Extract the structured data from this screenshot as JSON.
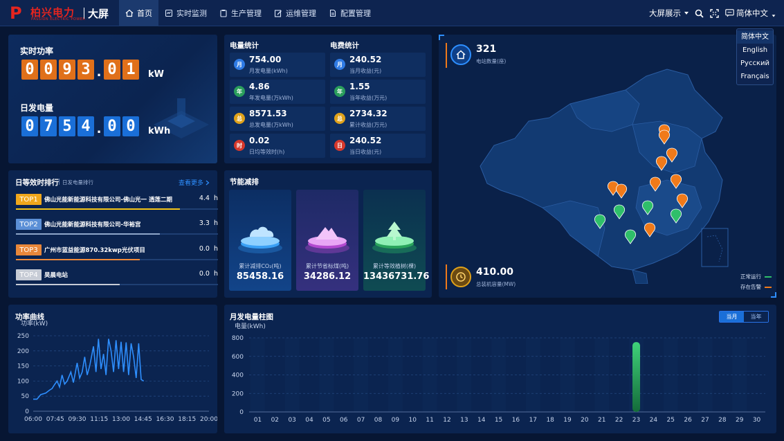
{
  "header": {
    "logo_text": "柏兴电力",
    "logo_subtext": "PASSION ELECTRIC POWER",
    "title": "大屏",
    "nav": [
      {
        "label": "首页",
        "icon": "home-icon",
        "active": true
      },
      {
        "label": "实时监测",
        "icon": "monitor-icon",
        "active": false
      },
      {
        "label": "生产管理",
        "icon": "clipboard-icon",
        "active": false
      },
      {
        "label": "运维管理",
        "icon": "edit-icon",
        "active": false
      },
      {
        "label": "配置管理",
        "icon": "document-icon",
        "active": false
      }
    ],
    "display_mode": "大屏展示",
    "language": "简体中文"
  },
  "language_menu": {
    "options": [
      "简体中文",
      "English",
      "Русский",
      "Français"
    ],
    "selected": "简体中文"
  },
  "power": {
    "realtime_label": "实时功率",
    "realtime_digits_int": [
      "0",
      "0",
      "9",
      "3"
    ],
    "realtime_digits_dec": [
      "0",
      "1"
    ],
    "realtime_unit": "kW",
    "daily_label": "日发电量",
    "daily_digits_int": [
      "0",
      "7",
      "5",
      "4"
    ],
    "daily_digits_dec": [
      "0",
      "0"
    ],
    "daily_unit": "kWh"
  },
  "generation_stats": {
    "title": "电量统计",
    "items": [
      {
        "badge": "月",
        "value": "754.00",
        "label": "月发电量(kWh)",
        "color": "#2f7be5"
      },
      {
        "badge": "年",
        "value": "4.86",
        "label": "年发电量(万kWh)",
        "color": "#2a9e5c"
      },
      {
        "badge": "总",
        "value": "8571.53",
        "label": "总发电量(万kWh)",
        "color": "#e0a21a"
      },
      {
        "badge": "时",
        "value": "0.02",
        "label": "日均等效时(h)",
        "color": "#d6382c"
      }
    ]
  },
  "revenue_stats": {
    "title": "电费统计",
    "items": [
      {
        "badge": "月",
        "value": "240.52",
        "label": "当月收益(元)",
        "color": "#2f7be5"
      },
      {
        "badge": "年",
        "value": "1.55",
        "label": "当年收益(万元)",
        "color": "#2a9e5c"
      },
      {
        "badge": "总",
        "value": "2734.32",
        "label": "累计收益(万元)",
        "color": "#e0a21a"
      },
      {
        "badge": "日",
        "value": "240.52",
        "label": "当日收益(元)",
        "color": "#d6382c"
      }
    ]
  },
  "ranking": {
    "title": "日等效时排行",
    "subtitle": "日发电量排行",
    "more": "查看更多",
    "rows": [
      {
        "tag": "TOP1",
        "name": "佛山光能新能源科技有限公司-佛山光一 透莲二期",
        "value": "4.4",
        "unit": "h",
        "progress": 0.78,
        "tag_color": "#f0a71c",
        "bar_color": "#f5c518"
      },
      {
        "tag": "TOP2",
        "name": "佛山光能新能源科技有限公司-华裕宫",
        "value": "3.3",
        "unit": "h",
        "progress": 0.68,
        "tag_color": "#5b8fd6",
        "bar_color": "#8fa7c9"
      },
      {
        "tag": "TOP3",
        "name": "广州市蓝益能源870.32kwp光伏项目",
        "value": "0.0",
        "unit": "h",
        "progress": 0.58,
        "tag_color": "#e8873a",
        "bar_color": "#f08a3a"
      },
      {
        "tag": "TOP4",
        "name": "昊晨电站",
        "value": "0.0",
        "unit": "h",
        "progress": 0.48,
        "tag_color": "#c7ccd6",
        "bar_color": "#c7ccd6"
      }
    ]
  },
  "energy_saving": {
    "title": "节能减排",
    "items": [
      {
        "label": "累计减排CO₂(吨)",
        "value": "85458.16",
        "icon": "cloud-icon",
        "color": "#2e8fe8"
      },
      {
        "label": "累计节省标煤(吨)",
        "value": "34286.12",
        "icon": "mountain-icon",
        "color": "#c04ad8"
      },
      {
        "label": "累计等效植树(棵)",
        "value": "13436731.76",
        "icon": "tree-icon",
        "color": "#2fbf6a"
      }
    ]
  },
  "map": {
    "station_count": "321",
    "station_label": "电站数量(座)",
    "capacity": "410.00",
    "capacity_label": "总装机容量(MW)",
    "legend_normal": "正常运行",
    "legend_alarm": "存在告警",
    "normal_color": "#2fbf6a",
    "alarm_color": "#f07a1a"
  },
  "power_curve": {
    "title": "功率曲线",
    "ylabel": "功率(kW)",
    "chart_data": {
      "type": "line",
      "x_ticks": [
        "06:00",
        "07:45",
        "09:30",
        "11:15",
        "13:00",
        "14:45",
        "16:30",
        "18:15",
        "20:00"
      ],
      "y_ticks": [
        0,
        50,
        100,
        150,
        200,
        250
      ],
      "ylim": [
        0,
        250
      ],
      "xlim_hours": [
        6,
        20
      ],
      "series": [
        {
          "color": "#2e8fff",
          "points": [
            [
              6.0,
              40
            ],
            [
              6.3,
              40
            ],
            [
              6.6,
              55
            ],
            [
              7.0,
              60
            ],
            [
              7.3,
              70
            ],
            [
              7.5,
              75
            ],
            [
              7.7,
              88
            ],
            [
              7.9,
              100
            ],
            [
              8.1,
              80
            ],
            [
              8.3,
              120
            ],
            [
              8.5,
              90
            ],
            [
              8.7,
              100
            ],
            [
              9.0,
              130
            ],
            [
              9.2,
              95
            ],
            [
              9.5,
              160
            ],
            [
              9.7,
              110
            ],
            [
              9.9,
              130
            ],
            [
              10.1,
              180
            ],
            [
              10.3,
              120
            ],
            [
              10.5,
              150
            ],
            [
              10.8,
              215
            ],
            [
              11.0,
              130
            ],
            [
              11.2,
              240
            ],
            [
              11.4,
              140
            ],
            [
              11.6,
              190
            ],
            [
              11.8,
              120
            ],
            [
              12.0,
              240
            ],
            [
              12.2,
              200
            ],
            [
              12.4,
              130
            ],
            [
              12.6,
              235
            ],
            [
              12.8,
              140
            ],
            [
              13.0,
              230
            ],
            [
              13.2,
              130
            ],
            [
              13.4,
              228
            ],
            [
              13.6,
              120
            ],
            [
              13.8,
              225
            ],
            [
              14.0,
              180
            ],
            [
              14.2,
              110
            ],
            [
              14.4,
              225
            ],
            [
              14.6,
              105
            ],
            [
              14.8,
              100
            ]
          ]
        }
      ]
    }
  },
  "monthly_chart": {
    "title": "月发电量柱图",
    "ylabel": "电量(kWh)",
    "toggle": [
      "当月",
      "当年"
    ],
    "toggle_active": "当月",
    "chart_data": {
      "type": "bar",
      "categories": [
        "01",
        "02",
        "03",
        "04",
        "05",
        "06",
        "07",
        "08",
        "09",
        "10",
        "11",
        "12",
        "13",
        "14",
        "15",
        "16",
        "17",
        "18",
        "19",
        "20",
        "21",
        "22",
        "23",
        "24",
        "25",
        "26",
        "27",
        "28",
        "29",
        "30"
      ],
      "values": [
        0,
        0,
        0,
        0,
        0,
        0,
        0,
        0,
        0,
        0,
        0,
        0,
        0,
        0,
        0,
        0,
        0,
        0,
        0,
        0,
        0,
        0,
        754,
        0,
        0,
        0,
        0,
        0,
        0,
        0
      ],
      "ylim": [
        0,
        800
      ],
      "y_ticks": [
        0,
        200,
        400,
        600,
        800
      ],
      "bar_color": "#2fbf6a"
    }
  }
}
